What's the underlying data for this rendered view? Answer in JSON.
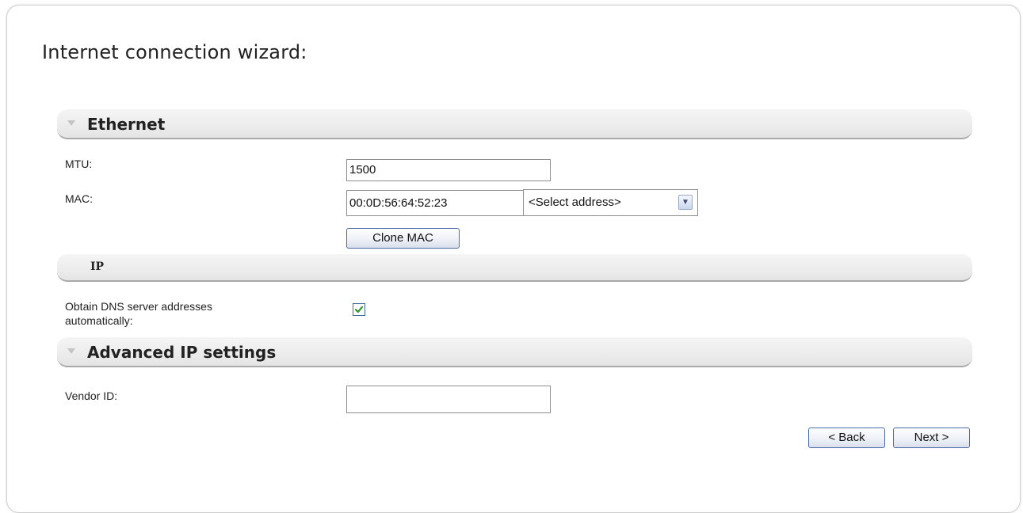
{
  "page": {
    "title": "Internet connection wizard:"
  },
  "sections": {
    "ethernet": "Ethernet",
    "ip": "IP",
    "advanced": "Advanced IP settings"
  },
  "ethernet": {
    "mtu_label": "MTU:",
    "mtu_value": "1500",
    "mac_label": "MAC:",
    "mac_value": "00:0D:56:64:52:23",
    "mac_select_value": "<Select address>",
    "clone_mac_label": "Clone MAC"
  },
  "ip": {
    "dns_label_line1": "Obtain DNS server addresses",
    "dns_label_line2": "automatically:",
    "dns_auto_checked": true
  },
  "advanced": {
    "vendor_id_label": "Vendor ID:",
    "vendor_id_value": ""
  },
  "buttons": {
    "back_label": "< Back",
    "next_label": "Next >"
  },
  "colors": {
    "button_border": "#4c6dab",
    "checkmark": "#2e9a2e",
    "section_bar": "#ececec"
  }
}
